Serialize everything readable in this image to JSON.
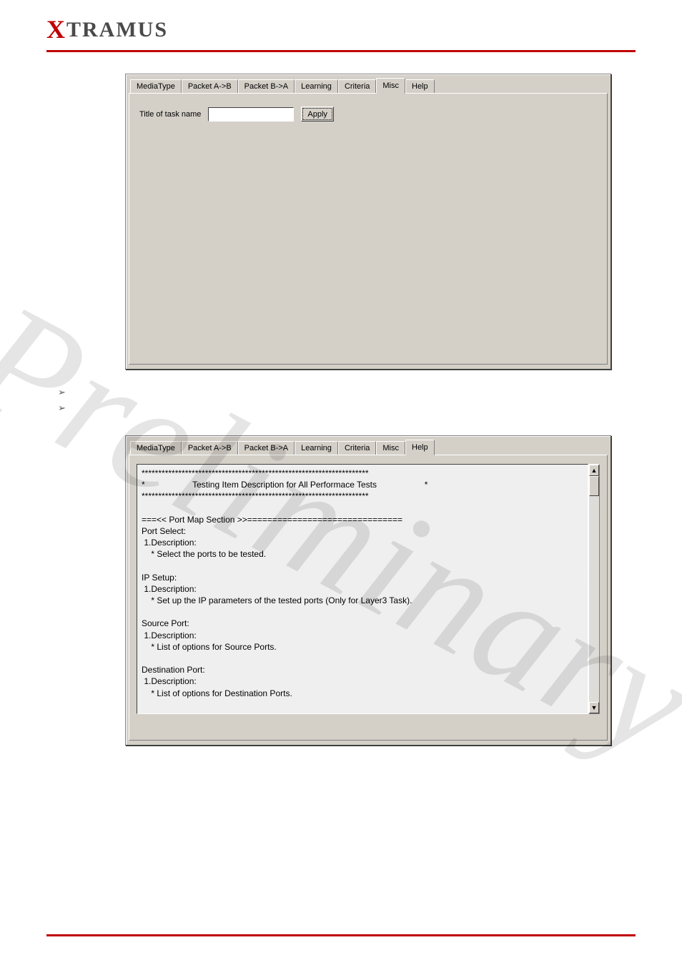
{
  "logo": {
    "prefix": "X",
    "rest": "TRAMUS"
  },
  "watermark": "Preliminary",
  "tabs": {
    "t0": "MediaType",
    "t1": "Packet A->B",
    "t2": "Packet B->A",
    "t3": "Learning",
    "t4": "Criteria",
    "t5": "Misc",
    "t6": "Help"
  },
  "misc": {
    "title_label": "Title of task name",
    "title_value": "",
    "apply_label": "Apply"
  },
  "help_text": "********************************************************************\n*                    Testing Item Description for All Performace Tests                    *\n********************************************************************\n\n===<< Port Map Section >>===============================\nPort Select:\n 1.Description:\n    * Select the ports to be tested.\n\nIP Setup:\n 1.Description:\n    * Set up the IP parameters of the tested ports (Only for Layer3 Task).\n\nSource Port:\n 1.Description:\n    * List of options for Source Ports.\n\nDestination Port:\n 1.Description:\n    * List of options for Destination Ports.",
  "scroll": {
    "up": "▲",
    "down": "▼"
  }
}
